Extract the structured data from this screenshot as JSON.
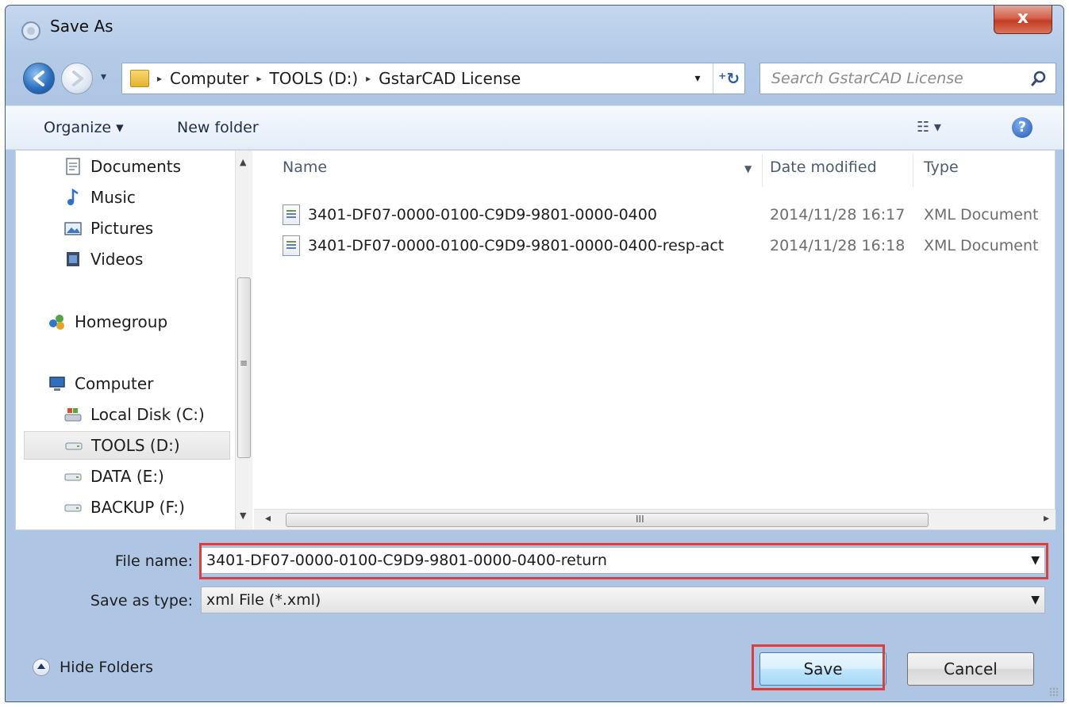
{
  "window": {
    "title": "Save As",
    "close_label": "x"
  },
  "nav": {
    "history_glyph": "▾"
  },
  "address": {
    "crumbs": [
      "Computer",
      "TOOLS (D:)",
      "GstarCAD License"
    ],
    "separator": "▸",
    "dropdown_glyph": "▾",
    "refresh_glyph": "⁺↻"
  },
  "search": {
    "placeholder": "Search GstarCAD License"
  },
  "toolbar": {
    "organize_label": "Organize ▾",
    "new_folder_label": "New folder",
    "views_glyph": "☷ ▾",
    "help_label": "?"
  },
  "sidebar": {
    "items": [
      {
        "label": "Documents",
        "icon": "documents-icon"
      },
      {
        "label": "Music",
        "icon": "music-icon"
      },
      {
        "label": "Pictures",
        "icon": "pictures-icon"
      },
      {
        "label": "Videos",
        "icon": "videos-icon"
      },
      {
        "label": "Homegroup",
        "icon": "homegroup-icon"
      },
      {
        "label": "Computer",
        "icon": "computer-icon"
      },
      {
        "label": "Local Disk (C:)",
        "icon": "local-disk-icon"
      },
      {
        "label": "TOOLS (D:)",
        "icon": "drive-icon",
        "selected": true
      },
      {
        "label": "DATA (E:)",
        "icon": "drive-icon"
      },
      {
        "label": "BACKUP (F:)",
        "icon": "drive-icon"
      }
    ],
    "scroll_grip": "≡",
    "scroll_up": "▲",
    "scroll_down": "▼"
  },
  "files": {
    "columns": {
      "name": "Name",
      "date": "Date modified",
      "type": "Type"
    },
    "rows": [
      {
        "name": "3401-DF07-0000-0100-C9D9-9801-0000-0400",
        "date": "2014/11/28 16:17",
        "type": "XML Document"
      },
      {
        "name": "3401-DF07-0000-0100-C9D9-9801-0000-0400-resp-act",
        "date": "2014/11/28 16:18",
        "type": "XML Document"
      }
    ],
    "hscroll_grip": "III",
    "hscroll_left": "◂",
    "hscroll_right": "▸"
  },
  "form": {
    "file_name_label": "File name:",
    "file_name_value": "3401-DF07-0000-0100-C9D9-9801-0000-0400-return",
    "save_type_label": "Save as type:",
    "save_type_value": "xml File (*.xml)",
    "combo_arrow": "▼"
  },
  "footer": {
    "hide_folders_label": "Hide Folders",
    "save_label": "Save",
    "cancel_label": "Cancel"
  },
  "colors": {
    "highlight": "#dc3d3d",
    "title_bar": "#b4cbe7",
    "close_button": "#c33b22"
  }
}
